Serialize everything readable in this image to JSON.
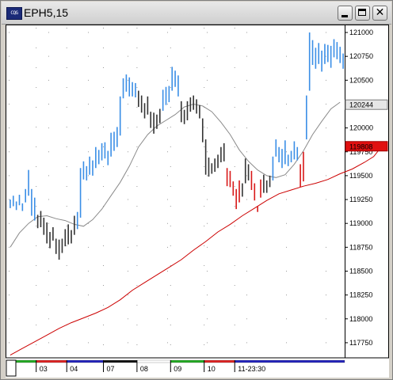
{
  "window": {
    "title": "EPH5,15",
    "icon_label": "CQG",
    "buttons": {
      "minimize": "minimize",
      "maximize": "maximize",
      "close": "close"
    }
  },
  "chart_data": {
    "type": "ohlc",
    "symbol": "EPH5",
    "interval_minutes": 15,
    "ylim": [
      117600,
      121050
    ],
    "yticks": [
      121000,
      120750,
      120500,
      120250,
      120000,
      119750,
      119500,
      119250,
      119000,
      118750,
      118500,
      118250,
      118000,
      117750
    ],
    "ytick_labels": [
      "121000",
      "120750",
      "120500",
      "120250",
      "120000",
      "119750",
      "119500",
      "119250",
      "119000",
      "118750",
      "118500",
      "118250",
      "118000",
      "117750"
    ],
    "price_badges": [
      {
        "label": "120244",
        "value": 120244,
        "style": "gray"
      },
      {
        "label": "119808",
        "value": 119808,
        "style": "red"
      }
    ],
    "sessions": [
      {
        "label": "",
        "start": 0,
        "color": "#22aa22"
      },
      {
        "label": "03",
        "start": 9,
        "color": "#dd2222"
      },
      {
        "label": "04",
        "start": 19,
        "color": "#2222bb"
      },
      {
        "label": "07",
        "start": 31,
        "color": "#111111"
      },
      {
        "label": "08",
        "start": 42,
        "color": "#ffffff"
      },
      {
        "label": "09",
        "start": 53,
        "color": "#22aa22"
      },
      {
        "label": "10",
        "start": 64,
        "color": "#dd2222"
      },
      {
        "label": "11-23:30",
        "start": 74,
        "color": "#2222bb"
      }
    ],
    "bars": [
      [
        119250,
        119160,
        "b"
      ],
      [
        119290,
        119180,
        "b"
      ],
      [
        119230,
        119140,
        "b"
      ],
      [
        119300,
        119190,
        "b"
      ],
      [
        119210,
        119130,
        "b"
      ],
      [
        119360,
        119220,
        "b"
      ],
      [
        119560,
        119290,
        "b"
      ],
      [
        119360,
        119080,
        "b"
      ],
      [
        119270,
        119030,
        "b"
      ],
      [
        119090,
        118950,
        "k"
      ],
      [
        119130,
        118960,
        "k"
      ],
      [
        119060,
        118880,
        "k"
      ],
      [
        119010,
        118790,
        "k"
      ],
      [
        118910,
        118740,
        "k"
      ],
      [
        118960,
        118820,
        "k"
      ],
      [
        118840,
        118680,
        "k"
      ],
      [
        118830,
        118620,
        "k"
      ],
      [
        118840,
        118690,
        "k"
      ],
      [
        118940,
        118760,
        "k"
      ],
      [
        118990,
        118780,
        "k"
      ],
      [
        118930,
        118790,
        "k"
      ],
      [
        119080,
        118880,
        "k"
      ],
      [
        119120,
        118940,
        "b"
      ],
      [
        119580,
        119060,
        "b"
      ],
      [
        119650,
        119460,
        "b"
      ],
      [
        119600,
        119450,
        "b"
      ],
      [
        119700,
        119510,
        "b"
      ],
      [
        119660,
        119500,
        "b"
      ],
      [
        119800,
        119580,
        "b"
      ],
      [
        119770,
        119620,
        "b"
      ],
      [
        119840,
        119660,
        "b"
      ],
      [
        119850,
        119680,
        "b"
      ],
      [
        119760,
        119610,
        "b"
      ],
      [
        119950,
        119700,
        "b"
      ],
      [
        119960,
        119760,
        "b"
      ],
      [
        120010,
        119800,
        "b"
      ],
      [
        120330,
        119920,
        "b"
      ],
      [
        120520,
        120310,
        "b"
      ],
      [
        120560,
        120380,
        "b"
      ],
      [
        120530,
        120330,
        "b"
      ],
      [
        120480,
        120330,
        "b"
      ],
      [
        120470,
        120320,
        "b"
      ],
      [
        120390,
        120220,
        "k"
      ],
      [
        120340,
        120160,
        "k"
      ],
      [
        120260,
        120100,
        "k"
      ],
      [
        120330,
        120140,
        "k"
      ],
      [
        120170,
        120000,
        "k"
      ],
      [
        120160,
        119940,
        "k"
      ],
      [
        120140,
        119990,
        "k"
      ],
      [
        120200,
        120050,
        "k"
      ],
      [
        120400,
        120180,
        "b"
      ],
      [
        120430,
        120240,
        "b"
      ],
      [
        120440,
        120270,
        "b"
      ],
      [
        120640,
        120390,
        "b"
      ],
      [
        120600,
        120430,
        "b"
      ],
      [
        120550,
        120330,
        "b"
      ],
      [
        120280,
        120060,
        "k"
      ],
      [
        120190,
        120040,
        "k"
      ],
      [
        120280,
        120080,
        "k"
      ],
      [
        120320,
        120170,
        "k"
      ],
      [
        120340,
        120190,
        "k"
      ],
      [
        120300,
        120150,
        "k"
      ],
      [
        120240,
        120100,
        "k"
      ],
      [
        120100,
        119850,
        "k"
      ],
      [
        119880,
        119510,
        "k"
      ],
      [
        119690,
        119490,
        "k"
      ],
      [
        119630,
        119520,
        "k"
      ],
      [
        119680,
        119540,
        "k"
      ],
      [
        119720,
        119580,
        "k"
      ],
      [
        119800,
        119640,
        "k"
      ],
      [
        119840,
        119650,
        "k"
      ],
      [
        119580,
        119390,
        "r"
      ],
      [
        119550,
        119380,
        "r"
      ],
      [
        119440,
        119290,
        "r"
      ],
      [
        119360,
        119150,
        "r"
      ],
      [
        119450,
        119220,
        "r"
      ],
      [
        119420,
        119280,
        "k"
      ],
      [
        119680,
        119420,
        "k"
      ],
      [
        119620,
        119450,
        "k"
      ],
      [
        119550,
        119350,
        "r"
      ],
      [
        119420,
        119240,
        "r"
      ],
      [
        119180,
        119120,
        "r"
      ],
      [
        119460,
        119270,
        "r"
      ],
      [
        119510,
        119320,
        "k"
      ],
      [
        119450,
        119320,
        "k"
      ],
      [
        119500,
        119380,
        "k"
      ],
      [
        119700,
        119450,
        "b"
      ],
      [
        119880,
        119700,
        "b"
      ],
      [
        119800,
        119640,
        "b"
      ],
      [
        119780,
        119580,
        "b"
      ],
      [
        119870,
        119620,
        "b"
      ],
      [
        119720,
        119600,
        "b"
      ],
      [
        119760,
        119640,
        "b"
      ],
      [
        119860,
        119670,
        "b"
      ],
      [
        119800,
        119660,
        "b"
      ],
      [
        119620,
        119380,
        "r"
      ],
      [
        119750,
        119440,
        "r"
      ],
      [
        120340,
        119880,
        "b"
      ],
      [
        121000,
        120390,
        "b"
      ],
      [
        120920,
        120660,
        "b"
      ],
      [
        120840,
        120620,
        "b"
      ],
      [
        120890,
        120670,
        "b"
      ],
      [
        120810,
        120590,
        "b"
      ],
      [
        120880,
        120670,
        "b"
      ],
      [
        120870,
        120690,
        "b"
      ],
      [
        120860,
        120630,
        "b"
      ],
      [
        120930,
        120740,
        "b"
      ],
      [
        120900,
        120720,
        "b"
      ],
      [
        120850,
        120680,
        "b"
      ],
      [
        120780,
        120620,
        "b"
      ]
    ],
    "bar_colors": {
      "b": "#3a8ee6",
      "k": "#333333",
      "r": "#d81818"
    },
    "series": [
      {
        "color": "#8a8a8a",
        "points": [
          [
            0,
            118750
          ],
          [
            3,
            118900
          ],
          [
            6,
            119000
          ],
          [
            9,
            119070
          ],
          [
            12,
            119080
          ],
          [
            15,
            119050
          ],
          [
            18,
            119030
          ],
          [
            21,
            118990
          ],
          [
            24,
            118970
          ],
          [
            27,
            119040
          ],
          [
            30,
            119150
          ],
          [
            33,
            119290
          ],
          [
            36,
            119430
          ],
          [
            39,
            119600
          ],
          [
            42,
            119800
          ],
          [
            45,
            119930
          ],
          [
            48,
            120020
          ],
          [
            51,
            120080
          ],
          [
            54,
            120140
          ],
          [
            57,
            120220
          ],
          [
            60,
            120250
          ],
          [
            63,
            120230
          ],
          [
            66,
            120170
          ],
          [
            69,
            120060
          ],
          [
            72,
            119930
          ],
          [
            75,
            119770
          ],
          [
            78,
            119650
          ],
          [
            81,
            119560
          ],
          [
            84,
            119500
          ],
          [
            87,
            119480
          ],
          [
            90,
            119510
          ],
          [
            93,
            119620
          ],
          [
            96,
            119760
          ],
          [
            99,
            119930
          ],
          [
            102,
            120070
          ],
          [
            105,
            120200
          ],
          [
            108,
            120270
          ]
        ]
      },
      {
        "color": "#cc0000",
        "points": [
          [
            0,
            117620
          ],
          [
            4,
            117690
          ],
          [
            8,
            117760
          ],
          [
            12,
            117830
          ],
          [
            16,
            117900
          ],
          [
            20,
            117960
          ],
          [
            24,
            118010
          ],
          [
            28,
            118060
          ],
          [
            32,
            118120
          ],
          [
            36,
            118200
          ],
          [
            40,
            118300
          ],
          [
            44,
            118380
          ],
          [
            48,
            118460
          ],
          [
            52,
            118540
          ],
          [
            56,
            118620
          ],
          [
            60,
            118720
          ],
          [
            64,
            118810
          ],
          [
            68,
            118910
          ],
          [
            72,
            118990
          ],
          [
            76,
            119080
          ],
          [
            80,
            119160
          ],
          [
            84,
            119240
          ],
          [
            88,
            119310
          ],
          [
            92,
            119350
          ],
          [
            96,
            119390
          ],
          [
            100,
            119420
          ],
          [
            104,
            119460
          ],
          [
            108,
            119520
          ],
          [
            112,
            119570
          ],
          [
            116,
            119640
          ],
          [
            119,
            119700
          ],
          [
            121,
            119780
          ]
        ]
      }
    ]
  }
}
